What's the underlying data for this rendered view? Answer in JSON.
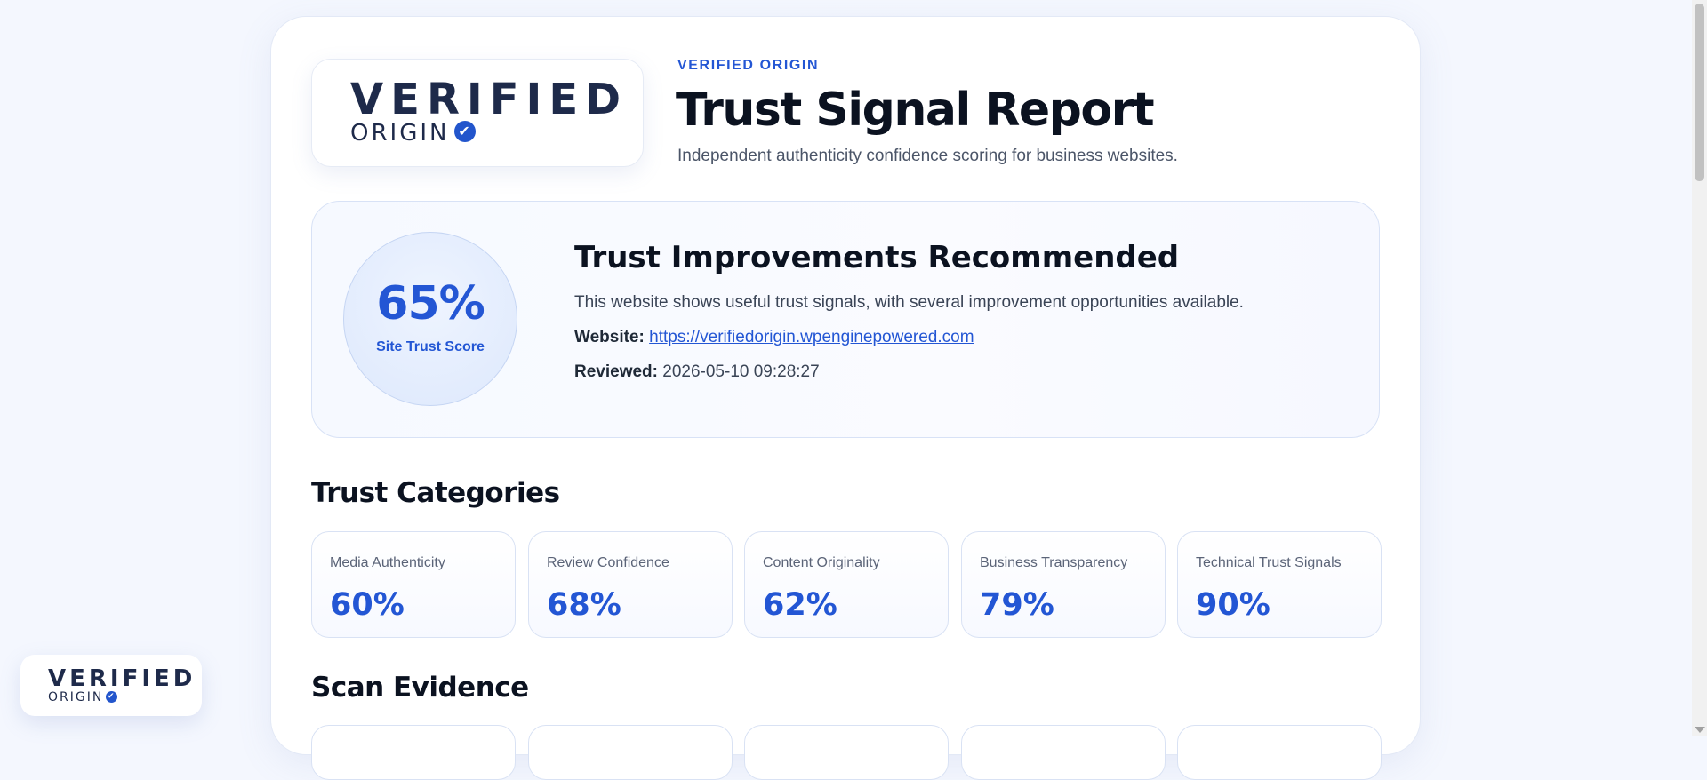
{
  "brand": {
    "logo_word": "VERIFIED",
    "logo_sub": "ORIGIN",
    "check_glyph": "✔"
  },
  "header": {
    "eyebrow": "VERIFIED ORIGIN",
    "title": "Trust Signal Report",
    "subtitle": "Independent authenticity confidence scoring for business websites."
  },
  "score": {
    "value": "65%",
    "label": "Site Trust Score",
    "heading": "Trust Improvements Recommended",
    "description": "This website shows useful trust signals, with several improvement opportunities available.",
    "website_label": "Website:",
    "website_url": "https://verifiedorigin.wpenginepowered.com",
    "reviewed_label": "Reviewed:",
    "reviewed_value": "2026-05-10 09:28:27"
  },
  "categories_title": "Trust Categories",
  "categories": [
    {
      "label": "Media Authenticity",
      "value": "60%"
    },
    {
      "label": "Review Confidence",
      "value": "68%"
    },
    {
      "label": "Content Originality",
      "value": "62%"
    },
    {
      "label": "Business Transparency",
      "value": "79%"
    },
    {
      "label": "Technical Trust Signals",
      "value": "90%"
    }
  ],
  "evidence_title": "Scan Evidence",
  "colors": {
    "accent": "#2356d4",
    "heading": "#0b1220",
    "background": "#f4f7fe"
  }
}
